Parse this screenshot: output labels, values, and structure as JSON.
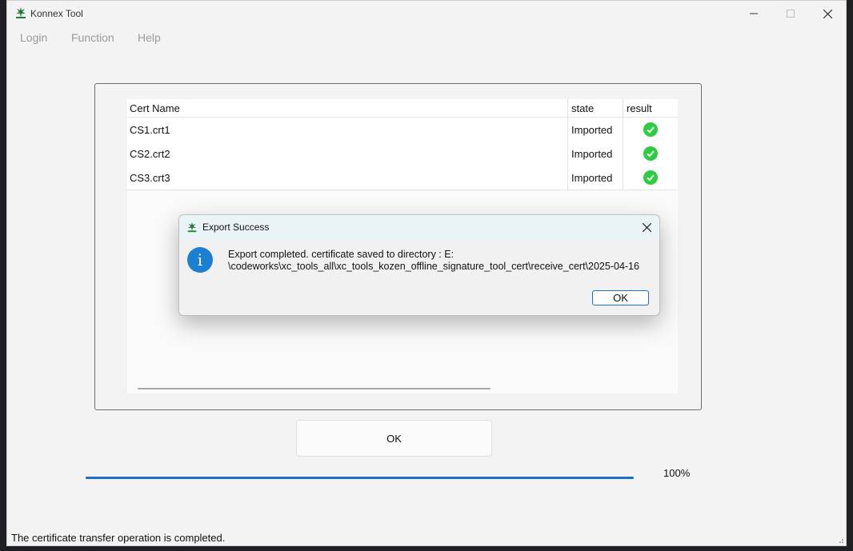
{
  "window": {
    "title": "Konnex Tool"
  },
  "menu": [
    {
      "label": "Login"
    },
    {
      "label": "Function"
    },
    {
      "label": "Help"
    }
  ],
  "table": {
    "columns": [
      "Cert Name",
      "state",
      "result"
    ],
    "rows": [
      {
        "name": "CS1.crt1",
        "state": "Imported",
        "result": "check"
      },
      {
        "name": "CS2.crt2",
        "state": "Imported",
        "result": "check"
      },
      {
        "name": "CS3.crt3",
        "state": "Imported",
        "result": "check"
      }
    ]
  },
  "main_button": {
    "label": "OK"
  },
  "progress": {
    "value": 1.0,
    "text": "100%"
  },
  "status_text": "The certificate transfer operation is completed.",
  "dialog": {
    "title": "Export Success",
    "message": "Export completed. certificate saved to directory : E:\\codeworks\\xc_tools_all\\xc_tools_kozen_offline_signature_tool_cert\\receive_cert\\2025-04-16",
    "message_line1": "Export completed. certificate saved to directory : E:",
    "message_line2": "\\codeworks\\xc_tools_all\\xc_tools_kozen_offline_signature_tool_cert\\receive_cert\\2025-04-16",
    "ok_label": "OK",
    "icon": "info-icon"
  },
  "colors": {
    "accent": "#1a6ec3",
    "success": "#2ecc40"
  }
}
